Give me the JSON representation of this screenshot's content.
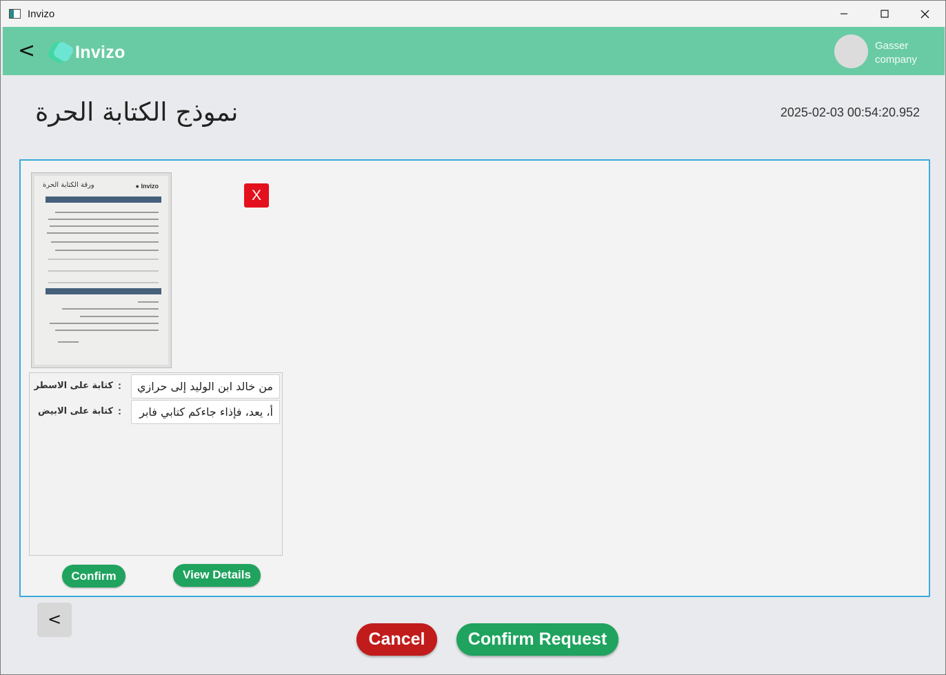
{
  "window": {
    "title": "Invizo",
    "controls": [
      "minimize-icon",
      "maximize-icon",
      "close-icon"
    ]
  },
  "header": {
    "back_label": "<",
    "logo_text": "Invizo",
    "user": {
      "line1": "Gasser",
      "line2": "company"
    },
    "color": "#69cba4"
  },
  "page": {
    "title": "نموذج الكتابة الحرة",
    "timestamp": "2025-02-03 00:54:20.952"
  },
  "document": {
    "remove_label": "X",
    "fields": [
      {
        "label": "كتابة على الاسطر",
        "colon": ":",
        "value": "من خالد ابن الوليد إلى حرازي"
      },
      {
        "label": "كتابة على الابيض",
        "colon": ":",
        "value": "أ، يعد، فإذاء جاءكم كتابي فابر"
      }
    ],
    "confirm_label": "Confirm",
    "details_label": "View Details"
  },
  "footer": {
    "prev_label": "<",
    "cancel_label": "Cancel",
    "confirm_request_label": "Confirm Request"
  },
  "colors": {
    "accent_green": "#1fa35e",
    "danger_red": "#c11b1b",
    "remove_red": "#e3111d",
    "panel_border": "#39a9dc"
  }
}
